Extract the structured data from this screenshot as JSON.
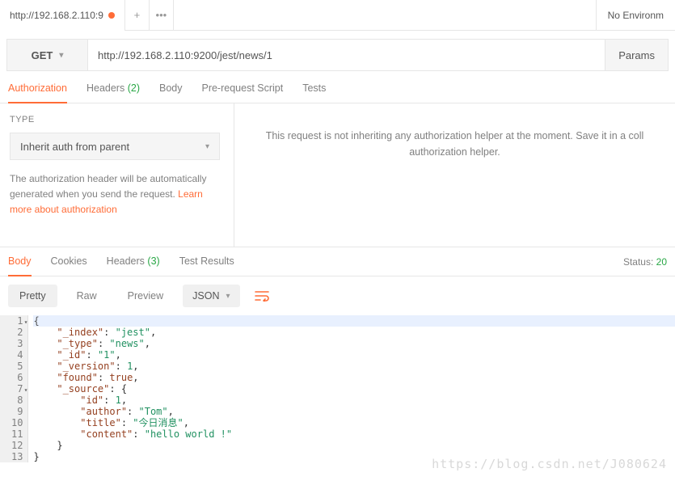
{
  "topbar": {
    "tab_title": "http://192.168.2.110:9",
    "env_label": "No Environm"
  },
  "request": {
    "method": "GET",
    "url": "http://192.168.2.110:9200/jest/news/1",
    "params_label": "Params"
  },
  "req_tabs": {
    "authorization": "Authorization",
    "headers": "Headers",
    "headers_count": "(2)",
    "body": "Body",
    "prerequest": "Pre-request Script",
    "tests": "Tests"
  },
  "auth": {
    "type_label": "TYPE",
    "selected": "Inherit auth from parent",
    "desc_prefix": "The authorization header will be automatically generated when you send the request. ",
    "link": "Learn more about authorization",
    "right_msg": "This request is not inheriting any authorization helper at the moment. Save it in a coll authorization helper."
  },
  "resp_tabs": {
    "body": "Body",
    "cookies": "Cookies",
    "headers": "Headers",
    "headers_count": "(3)",
    "test_results": "Test Results",
    "status_label": "Status:",
    "status_value": "20"
  },
  "view": {
    "pretty": "Pretty",
    "raw": "Raw",
    "preview": "Preview",
    "format": "JSON"
  },
  "code": {
    "lines": [
      {
        "n": "1",
        "fold": true,
        "html": "{"
      },
      {
        "n": "2",
        "html": "    <span class='k'>\"_index\"</span><span class='p'>: </span><span class='s'>\"jest\"</span><span class='p'>,</span>"
      },
      {
        "n": "3",
        "html": "    <span class='k'>\"_type\"</span><span class='p'>: </span><span class='s'>\"news\"</span><span class='p'>,</span>"
      },
      {
        "n": "4",
        "html": "    <span class='k'>\"_id\"</span><span class='p'>: </span><span class='s'>\"1\"</span><span class='p'>,</span>"
      },
      {
        "n": "5",
        "html": "    <span class='k'>\"_version\"</span><span class='p'>: </span><span class='n'>1</span><span class='p'>,</span>"
      },
      {
        "n": "6",
        "html": "    <span class='k'>\"found\"</span><span class='p'>: </span><span class='b'>true</span><span class='p'>,</span>"
      },
      {
        "n": "7",
        "fold": true,
        "html": "    <span class='k'>\"_source\"</span><span class='p'>: {</span>"
      },
      {
        "n": "8",
        "html": "        <span class='k'>\"id\"</span><span class='p'>: </span><span class='n'>1</span><span class='p'>,</span>"
      },
      {
        "n": "9",
        "html": "        <span class='k'>\"author\"</span><span class='p'>: </span><span class='s'>\"Tom\"</span><span class='p'>,</span>"
      },
      {
        "n": "10",
        "html": "        <span class='k'>\"title\"</span><span class='p'>: </span><span class='s'>\"今日消息\"</span><span class='p'>,</span>"
      },
      {
        "n": "11",
        "html": "        <span class='k'>\"content\"</span><span class='p'>: </span><span class='s'>\"hello world !\"</span>"
      },
      {
        "n": "12",
        "html": "    <span class='p'>}</span>"
      },
      {
        "n": "13",
        "html": "<span class='p'>}</span>"
      }
    ]
  },
  "watermark": "https://blog.csdn.net/J080624"
}
